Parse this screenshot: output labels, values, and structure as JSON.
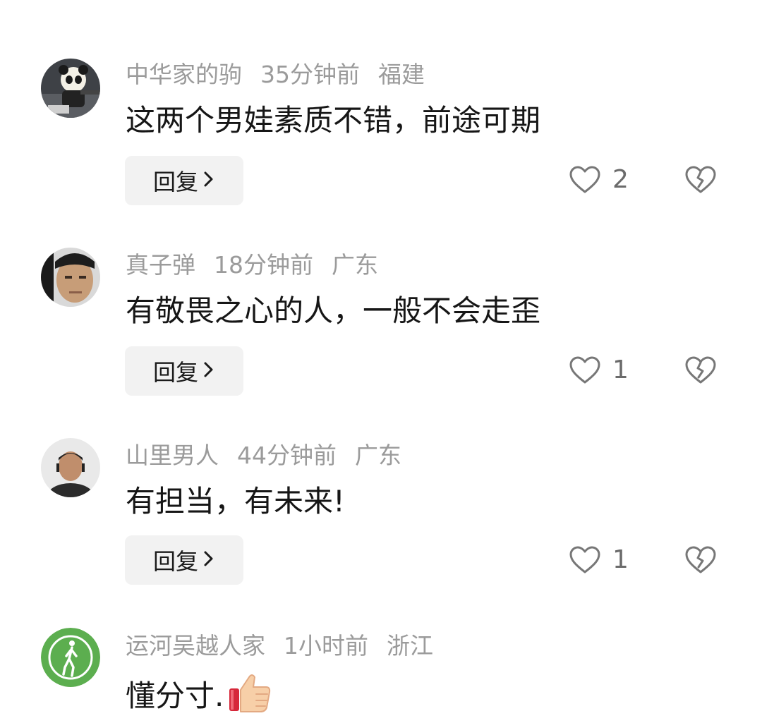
{
  "comments": [
    {
      "username": "中华家的驹",
      "time": "35分钟前",
      "location": "福建",
      "text": "这两个男娃素质不错，前途可期",
      "reply_label": "回复",
      "likes": "2",
      "avatar": "panda-avatar"
    },
    {
      "username": "真子弹",
      "time": "18分钟前",
      "location": "广东",
      "text": "有敬畏之心的人，一般不会走歪",
      "reply_label": "回复",
      "likes": "1",
      "avatar": "man-portrait-avatar"
    },
    {
      "username": "山里男人",
      "time": "44分钟前",
      "location": "广东",
      "text": "有担当，有未来!",
      "reply_label": "回复",
      "likes": "1",
      "avatar": "man-photo-avatar"
    },
    {
      "username": "运河吴越人家",
      "time": "1小时前",
      "location": "浙江",
      "text": "懂分寸.",
      "emoji": "thumbs-up",
      "avatar": "green-walker-avatar"
    }
  ],
  "colors": {
    "meta": "#9b9b9b",
    "text": "#161616",
    "reply_bg": "#f2f2f2",
    "icon": "#777777",
    "green_avatar": "#5cae4f"
  }
}
